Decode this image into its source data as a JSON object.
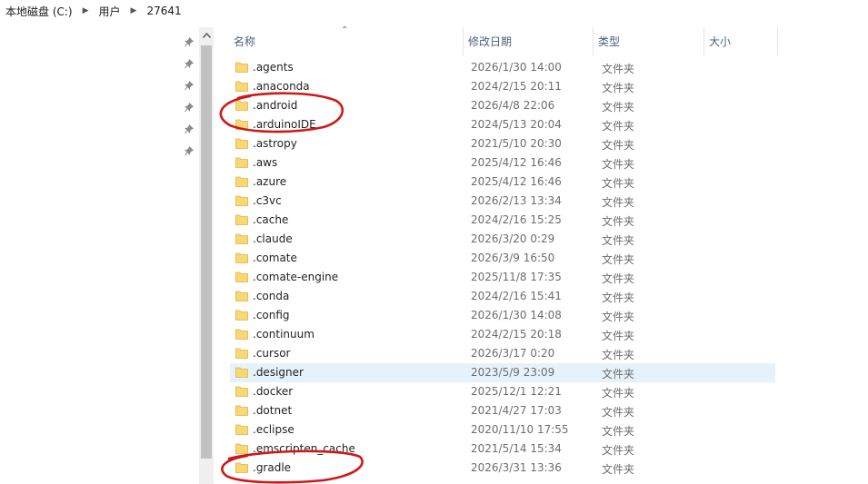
{
  "breadcrumb": [
    "本地磁盘 (C:)",
    "用户",
    "27641"
  ],
  "columns": {
    "name": "名称",
    "date": "修改日期",
    "type": "类型",
    "size": "大小"
  },
  "pinned_icon": "pin-icon",
  "files": [
    {
      "name": ".agents",
      "date": "2026/1/30 14:00",
      "type": "文件夹"
    },
    {
      "name": ".anaconda",
      "date": "2024/2/15 20:11",
      "type": "文件夹"
    },
    {
      "name": ".android",
      "date": "2026/4/8 22:06",
      "type": "文件夹"
    },
    {
      "name": ".arduinoIDE",
      "date": "2024/5/13 20:04",
      "type": "文件夹"
    },
    {
      "name": ".astropy",
      "date": "2021/5/10 20:30",
      "type": "文件夹"
    },
    {
      "name": ".aws",
      "date": "2025/4/12 16:46",
      "type": "文件夹"
    },
    {
      "name": ".azure",
      "date": "2025/4/12 16:46",
      "type": "文件夹"
    },
    {
      "name": ".c3vc",
      "date": "2026/2/13 13:34",
      "type": "文件夹"
    },
    {
      "name": ".cache",
      "date": "2024/2/16 15:25",
      "type": "文件夹"
    },
    {
      "name": ".claude",
      "date": "2026/3/20 0:29",
      "type": "文件夹"
    },
    {
      "name": ".comate",
      "date": "2026/3/9 16:50",
      "type": "文件夹"
    },
    {
      "name": ".comate-engine",
      "date": "2025/11/8 17:35",
      "type": "文件夹"
    },
    {
      "name": ".conda",
      "date": "2024/2/16 15:41",
      "type": "文件夹"
    },
    {
      "name": ".config",
      "date": "2026/1/30 14:08",
      "type": "文件夹"
    },
    {
      "name": ".continuum",
      "date": "2024/2/15 20:18",
      "type": "文件夹"
    },
    {
      "name": ".cursor",
      "date": "2026/3/17 0:20",
      "type": "文件夹"
    },
    {
      "name": ".designer",
      "date": "2023/5/9 23:09",
      "type": "文件夹",
      "selected": true
    },
    {
      "name": ".docker",
      "date": "2025/12/1 12:21",
      "type": "文件夹"
    },
    {
      "name": ".dotnet",
      "date": "2021/4/27 17:03",
      "type": "文件夹"
    },
    {
      "name": ".eclipse",
      "date": "2020/11/10 17:55",
      "type": "文件夹"
    },
    {
      "name": ".emscripten_cache",
      "date": "2021/5/14 15:34",
      "type": "文件夹"
    },
    {
      "name": ".gradle",
      "date": "2026/3/31 13:36",
      "type": "文件夹"
    }
  ],
  "colors": {
    "folder": "#f8d775",
    "folder_edge": "#e0b441",
    "selection": "#e6f2fb",
    "annotation": "#d01717",
    "header_text": "#4c607a"
  }
}
